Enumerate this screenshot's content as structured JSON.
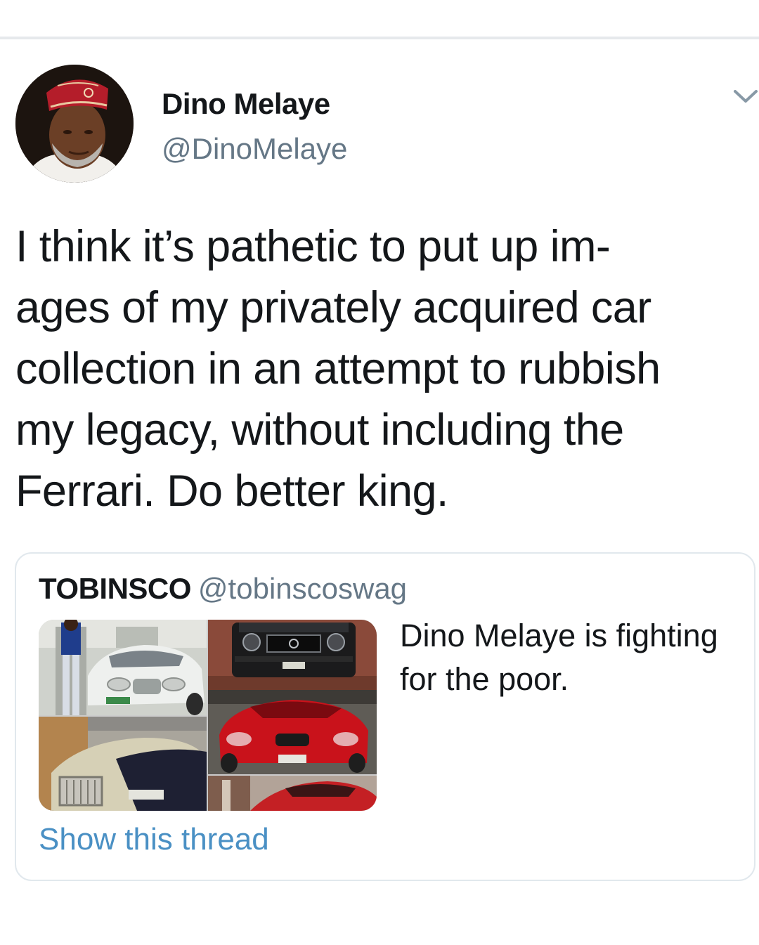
{
  "tweet": {
    "author": {
      "display_name": "Dino Melaye",
      "handle": "@DinoMelaye"
    },
    "text_lines": [
      "I think it’s pathetic to put up im-",
      "ages of my privately acquired car",
      "collection in an attempt to rubbish",
      "my legacy, without including the",
      "Ferrari. Do better king."
    ],
    "menu_icon": "chevron-down-icon"
  },
  "quoted_tweet": {
    "author_name": "TOBINSCO",
    "author_handle": "@tobinscoswag",
    "text_lines": [
      "Dino Melaye is fighting",
      "for the poor."
    ],
    "show_thread_label": "Show this thread"
  },
  "colors": {
    "text_primary": "#14171a",
    "text_secondary": "#657786",
    "link": "#4a90c4",
    "border": "#e1e8ed"
  }
}
